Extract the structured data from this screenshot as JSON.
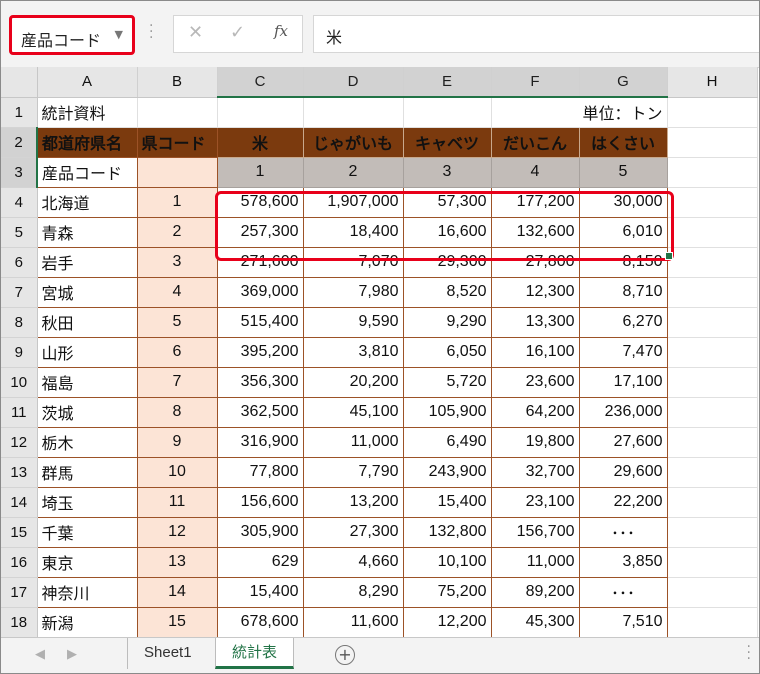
{
  "formula_bar": {
    "name_box": "産品コード",
    "cancel_icon": "✕",
    "enter_icon": "✓",
    "fx_label": "fx",
    "content": "米"
  },
  "columns": [
    "A",
    "B",
    "C",
    "D",
    "E",
    "F",
    "G",
    "H"
  ],
  "rows": [
    {
      "n": "1",
      "a": "統計資料",
      "unit": "単位：トン"
    },
    {
      "n": "2",
      "a": "都道府県名",
      "b": "県コード",
      "c": "米",
      "d": "じゃがいも",
      "e": "キャベツ",
      "f": "だいこん",
      "g": "はくさい"
    },
    {
      "n": "3",
      "a": "産品コード",
      "b": "",
      "c": "1",
      "d": "2",
      "e": "3",
      "f": "4",
      "g": "5"
    },
    {
      "n": "4",
      "a": "北海道",
      "b": "1",
      "c": "578,600",
      "d": "1,907,000",
      "e": "57,300",
      "f": "177,200",
      "g": "30,000"
    },
    {
      "n": "5",
      "a": "青森",
      "b": "2",
      "c": "257,300",
      "d": "18,400",
      "e": "16,600",
      "f": "132,600",
      "g": "6,010"
    },
    {
      "n": "6",
      "a": "岩手",
      "b": "3",
      "c": "271,600",
      "d": "7,070",
      "e": "29,300",
      "f": "27,800",
      "g": "8,150"
    },
    {
      "n": "7",
      "a": "宮城",
      "b": "4",
      "c": "369,000",
      "d": "7,980",
      "e": "8,520",
      "f": "12,300",
      "g": "8,710"
    },
    {
      "n": "8",
      "a": "秋田",
      "b": "5",
      "c": "515,400",
      "d": "9,590",
      "e": "9,290",
      "f": "13,300",
      "g": "6,270"
    },
    {
      "n": "9",
      "a": "山形",
      "b": "6",
      "c": "395,200",
      "d": "3,810",
      "e": "6,050",
      "f": "16,100",
      "g": "7,470"
    },
    {
      "n": "10",
      "a": "福島",
      "b": "7",
      "c": "356,300",
      "d": "20,200",
      "e": "5,720",
      "f": "23,600",
      "g": "17,100"
    },
    {
      "n": "11",
      "a": "茨城",
      "b": "8",
      "c": "362,500",
      "d": "45,100",
      "e": "105,900",
      "f": "64,200",
      "g": "236,000"
    },
    {
      "n": "12",
      "a": "栃木",
      "b": "9",
      "c": "316,900",
      "d": "11,000",
      "e": "6,490",
      "f": "19,800",
      "g": "27,600"
    },
    {
      "n": "13",
      "a": "群馬",
      "b": "10",
      "c": "77,800",
      "d": "7,790",
      "e": "243,900",
      "f": "32,700",
      "g": "29,600"
    },
    {
      "n": "14",
      "a": "埼玉",
      "b": "11",
      "c": "156,600",
      "d": "13,200",
      "e": "15,400",
      "f": "23,100",
      "g": "22,200"
    },
    {
      "n": "15",
      "a": "千葉",
      "b": "12",
      "c": "305,900",
      "d": "27,300",
      "e": "132,800",
      "f": "156,700",
      "g": "･･･"
    },
    {
      "n": "16",
      "a": "東京",
      "b": "13",
      "c": "629",
      "d": "4,660",
      "e": "10,100",
      "f": "11,000",
      "g": "3,850"
    },
    {
      "n": "17",
      "a": "神奈川",
      "b": "14",
      "c": "15,400",
      "d": "8,290",
      "e": "75,200",
      "f": "89,200",
      "g": "･･･"
    },
    {
      "n": "18",
      "a": "新潟",
      "b": "15",
      "c": "678,600",
      "d": "11,600",
      "e": "12,200",
      "f": "45,300",
      "g": "7,510"
    }
  ],
  "sheet_tabs": [
    "Sheet1",
    "統計表"
  ],
  "active_tab": "統計表",
  "add_sheet": "+",
  "colors": {
    "header_brown": "#7b3a0e",
    "key_pink": "#fce4d6",
    "highlight_red": "#e8001a",
    "excel_green": "#217346"
  }
}
